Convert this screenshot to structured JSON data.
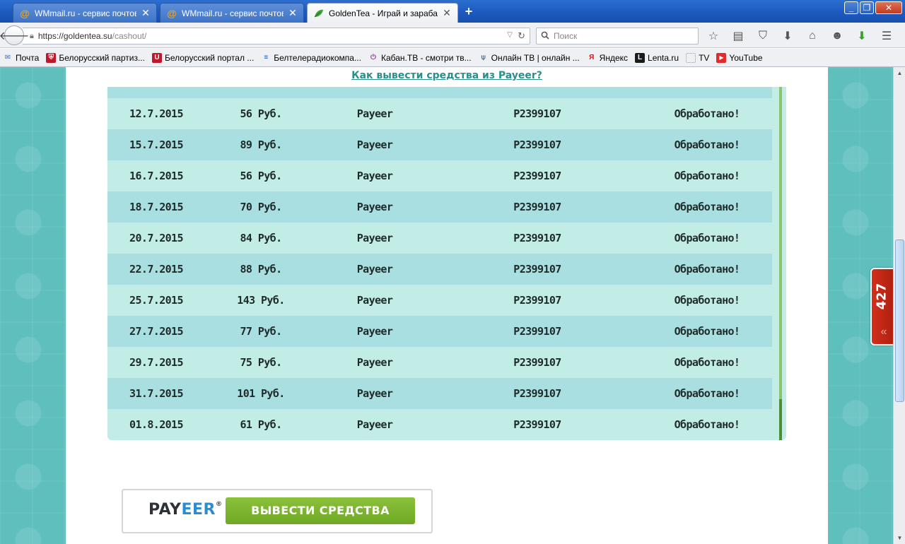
{
  "browser": {
    "tabs": [
      {
        "title": "WMmail.ru - сервис почтовы...",
        "favicon": "at-icon"
      },
      {
        "title": "WMmail.ru - сервис почтовы...",
        "favicon": "at-icon"
      },
      {
        "title": "GoldenTea - Играй и зараба...",
        "favicon": "leaf-icon"
      }
    ],
    "url_host": "https://goldentea.su",
    "url_path": "/cashout/",
    "search_placeholder": "Поиск",
    "bookmarks": [
      {
        "label": "Почта",
        "icon": "mail-icon",
        "color": "#3a6fc4"
      },
      {
        "label": "Белорусский партиз...",
        "icon": "shield-icon",
        "color": "#c0172b"
      },
      {
        "label": "Белорусский портал ...",
        "icon": "tut-icon",
        "color": "#c0172b"
      },
      {
        "label": "Белтелерадиокомпа...",
        "icon": "btrc-icon",
        "color": "#1a4fa0"
      },
      {
        "label": "Кабан.ТВ - смотри тв...",
        "icon": "power-icon",
        "color": "#9b3aa0"
      },
      {
        "label": "Онлайн ТВ | онлайн ...",
        "icon": "tv-antenna-icon",
        "color": "#2a6bc7"
      },
      {
        "label": "Яндекс",
        "icon": "yandex-icon",
        "color": "#d31616"
      },
      {
        "label": "Lenta.ru",
        "icon": "lenta-icon",
        "color": "#1b1b1b"
      },
      {
        "label": "TV",
        "icon": "folder-dotted-icon",
        "color": "#999999"
      },
      {
        "label": "YouTube",
        "icon": "youtube-icon",
        "color": "#e22b2b"
      }
    ]
  },
  "page": {
    "help_link": "Как вывести средства из Payeer?",
    "payouts": [
      {
        "date": "12.7.2015",
        "amount": "56 Руб.",
        "system": "Payeer",
        "account": "P2399107",
        "status": "Обработано!"
      },
      {
        "date": "15.7.2015",
        "amount": "89 Руб.",
        "system": "Payeer",
        "account": "P2399107",
        "status": "Обработано!"
      },
      {
        "date": "16.7.2015",
        "amount": "56 Руб.",
        "system": "Payeer",
        "account": "P2399107",
        "status": "Обработано!"
      },
      {
        "date": "18.7.2015",
        "amount": "70 Руб.",
        "system": "Payeer",
        "account": "P2399107",
        "status": "Обработано!"
      },
      {
        "date": "20.7.2015",
        "amount": "84 Руб.",
        "system": "Payeer",
        "account": "P2399107",
        "status": "Обработано!"
      },
      {
        "date": "22.7.2015",
        "amount": "88 Руб.",
        "system": "Payeer",
        "account": "P2399107",
        "status": "Обработано!"
      },
      {
        "date": "25.7.2015",
        "amount": "143 Руб.",
        "system": "Payeer",
        "account": "P2399107",
        "status": "Обработано!"
      },
      {
        "date": "27.7.2015",
        "amount": "77 Руб.",
        "system": "Payeer",
        "account": "P2399107",
        "status": "Обработано!"
      },
      {
        "date": "29.7.2015",
        "amount": "75 Руб.",
        "system": "Payeer",
        "account": "P2399107",
        "status": "Обработано!"
      },
      {
        "date": "31.7.2015",
        "amount": "101 Руб.",
        "system": "Payeer",
        "account": "P2399107",
        "status": "Обработано!"
      },
      {
        "date": "01.8.2015",
        "amount": "61 Руб.",
        "system": "Payeer",
        "account": "P2399107",
        "status": "Обработано!"
      }
    ],
    "payeer_logo_a": "PAY",
    "payeer_logo_b": "EER",
    "payeer_logo_reg": "®",
    "withdraw_button": "ВЫВЕСТИ СРЕДСТВА",
    "side_counter": "427"
  },
  "colors": {
    "page_bg": "#5fbfbd",
    "row_dark": "#a9dfe0",
    "row_light": "#c2ece6",
    "link": "#2a8f8c",
    "button_green": "#7cb431",
    "payeer_blue": "#2d8bcf",
    "counter_red": "#c8291a"
  }
}
